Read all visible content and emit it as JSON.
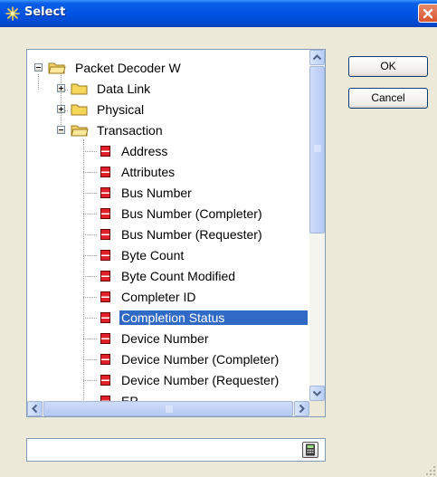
{
  "window": {
    "title": "Select",
    "icon": "asterisk-app-icon"
  },
  "buttons": {
    "ok": "OK",
    "cancel": "Cancel"
  },
  "tree": {
    "root": {
      "label": "Packet Decoder W",
      "expanded": true
    },
    "groups": [
      {
        "label": "Data Link",
        "expanded": false
      },
      {
        "label": "Physical",
        "expanded": false
      },
      {
        "label": "Transaction",
        "expanded": true
      }
    ],
    "items": [
      {
        "label": "Address",
        "selected": false
      },
      {
        "label": "Attributes",
        "selected": false
      },
      {
        "label": "Bus Number",
        "selected": false
      },
      {
        "label": "Bus Number (Completer)",
        "selected": false
      },
      {
        "label": "Bus Number (Requester)",
        "selected": false
      },
      {
        "label": "Byte Count",
        "selected": false
      },
      {
        "label": "Byte Count Modified",
        "selected": false
      },
      {
        "label": "Completer ID",
        "selected": false
      },
      {
        "label": "Completion Status",
        "selected": true
      },
      {
        "label": "Device Number",
        "selected": false
      },
      {
        "label": "Device Number (Completer)",
        "selected": false
      },
      {
        "label": "Device Number (Requester)",
        "selected": false
      },
      {
        "label": "EP",
        "selected": false
      }
    ]
  },
  "input": {
    "value": "",
    "placeholder": ""
  },
  "colors": {
    "selection": "#316ac5",
    "titlebar": "#0054e3",
    "leaf_icon": "#e0202a",
    "folder": "#f5d55a"
  }
}
